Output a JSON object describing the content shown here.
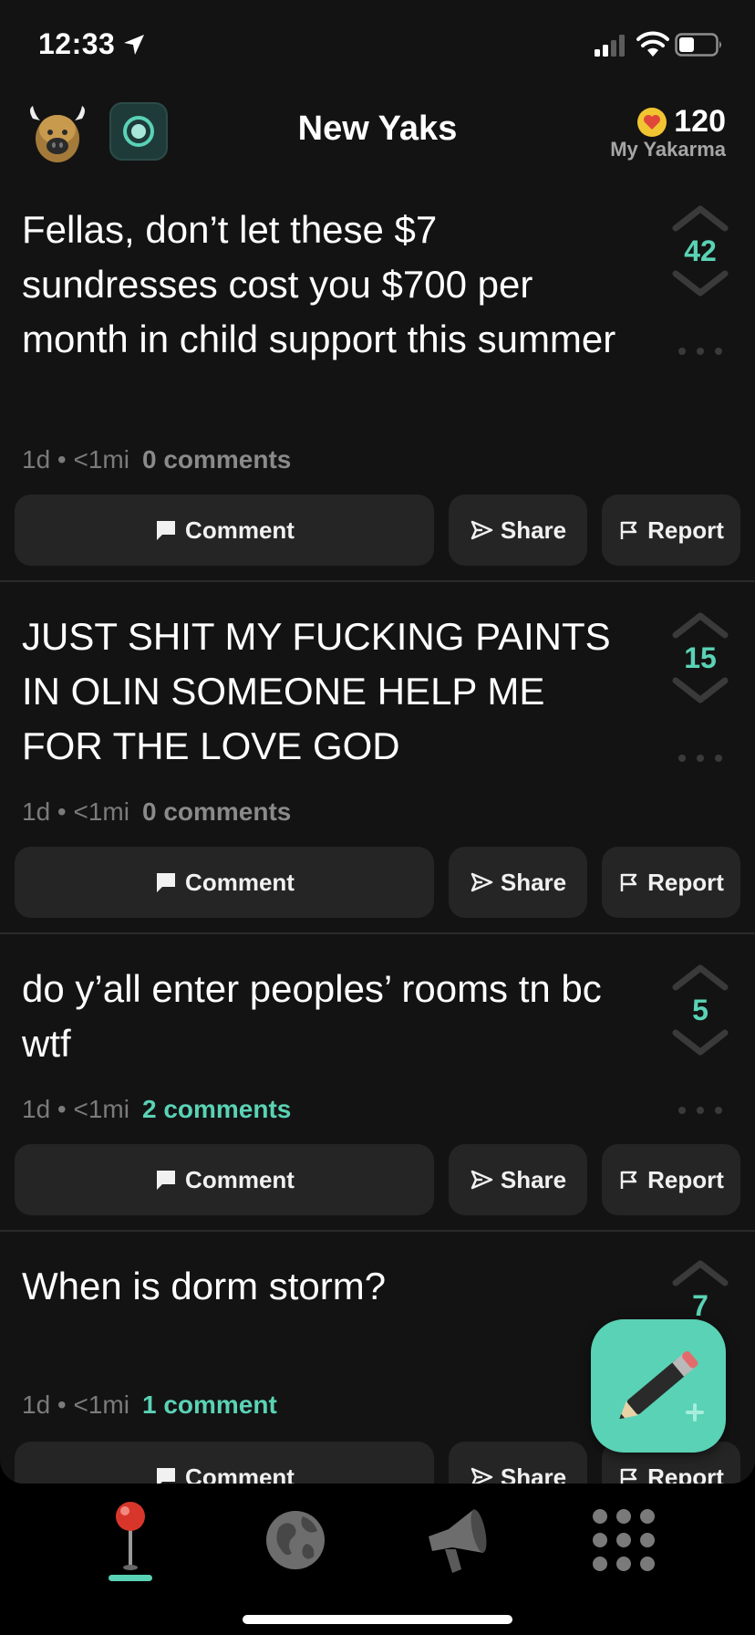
{
  "status_bar": {
    "time": "12:33"
  },
  "header": {
    "title": "New Yaks",
    "yakarma_score": "120",
    "yakarma_label": "My Yakarma"
  },
  "posts": [
    {
      "text": "Fellas, don’t let these $7 sundresses cost you $700 per month in child support this summer",
      "meta": "1d • <1mi",
      "comments": "0 comments",
      "votes": "42"
    },
    {
      "text": "JUST SHIT MY FUCKING PAINTS IN OLIN SOMEONE HELP ME FOR THE LOVE GOD",
      "meta": "1d • <1mi",
      "comments": "0 comments",
      "votes": "15"
    },
    {
      "text": "do y’all enter peoples’ rooms tn bc wtf",
      "meta": "1d • <1mi",
      "comments": "2 comments",
      "votes": "5"
    },
    {
      "text": "When is dorm storm?",
      "meta": "1d • <1mi",
      "comments": "1 comment",
      "votes": "7"
    }
  ],
  "actions": {
    "comment": "Comment",
    "share": "Share",
    "report": "Report"
  },
  "tabs": [
    {
      "icon": "map-pin-icon",
      "active": true
    },
    {
      "icon": "globe-icon",
      "active": false
    },
    {
      "icon": "megaphone-icon",
      "active": false
    },
    {
      "icon": "grid-menu-icon",
      "active": false
    }
  ],
  "colors": {
    "accent": "#5ad2b5",
    "background": "#131313",
    "button": "#252525",
    "muted": "#7b7b7b"
  }
}
